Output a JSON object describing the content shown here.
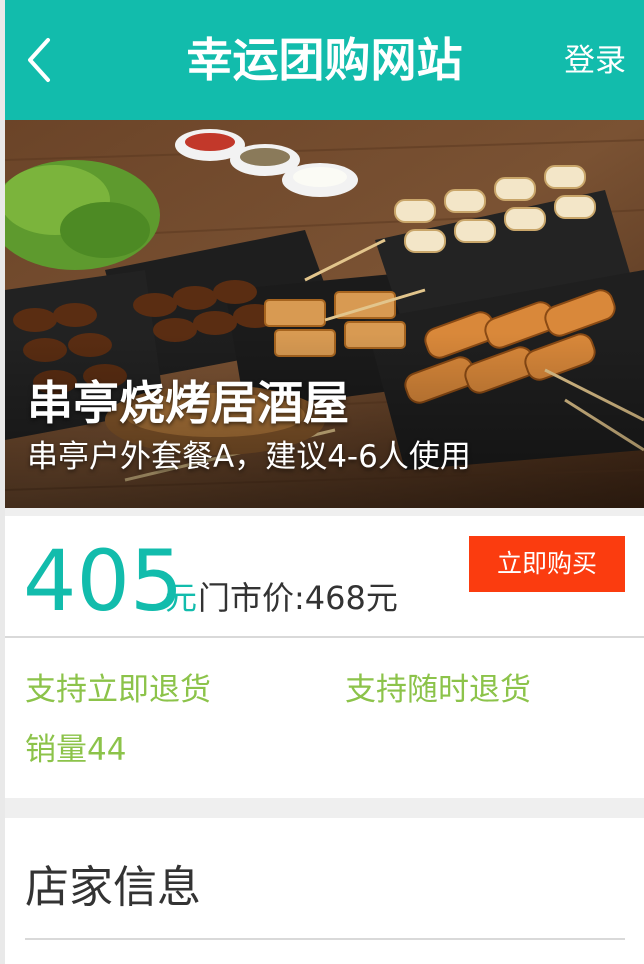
{
  "header": {
    "title": "幸运团购网站",
    "login_label": "登录",
    "back_icon": "chevron-left-icon"
  },
  "hero": {
    "store_name": "串亭烧烤居酒屋",
    "package": "串亭户外套餐A，建议4-6人使用"
  },
  "deal": {
    "price": "405",
    "price_unit": "元",
    "market_price": "门市价:468元",
    "buy_label": "立即购买"
  },
  "features": [
    "支持立即退货",
    "支持随时退货",
    "销量44"
  ],
  "store": {
    "section_title": "店家信息"
  },
  "colors": {
    "brand": "#12bcac",
    "buy_button": "#fb3c0f",
    "feature_text": "#8cc34a"
  }
}
